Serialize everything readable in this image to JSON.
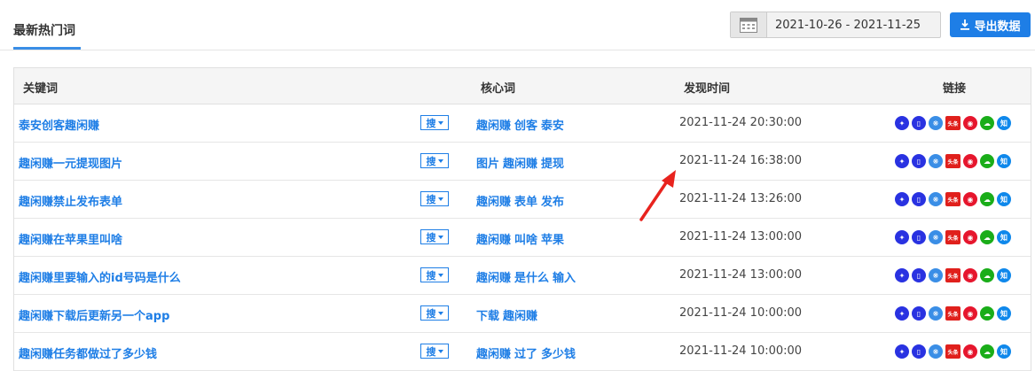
{
  "tab": {
    "label": "最新热门词"
  },
  "date_range": {
    "value": "2021-10-26 - 2021-11-25"
  },
  "export": {
    "label": "导出数据"
  },
  "table": {
    "headers": {
      "keyword": "关键词",
      "core": "核心词",
      "time": "发现时间",
      "links": "链接"
    },
    "search_label": "搜",
    "link_icons": [
      "baidu-icon",
      "mobile-icon",
      "360-icon",
      "toutiao-icon",
      "weibo-icon",
      "wechat-icon",
      "zhihu-icon"
    ],
    "toutiao_text": "头条",
    "zhihu_text": "知",
    "rows": [
      {
        "keyword": "泰安创客趣闲赚",
        "core": [
          "趣闲赚",
          "创客",
          "泰安"
        ],
        "time": "2021-11-24 20:30:00"
      },
      {
        "keyword": "趣闲赚一元提现图片",
        "core": [
          "图片",
          "趣闲赚",
          "提现"
        ],
        "time": "2021-11-24 16:38:00"
      },
      {
        "keyword": "趣闲赚禁止发布表单",
        "core": [
          "趣闲赚",
          "表单",
          "发布"
        ],
        "time": "2021-11-24 13:26:00"
      },
      {
        "keyword": "趣闲赚在苹果里叫啥",
        "core": [
          "趣闲赚",
          "叫啥",
          "苹果"
        ],
        "time": "2021-11-24 13:00:00"
      },
      {
        "keyword": "趣闲赚里要输入的id号码是什么",
        "core": [
          "趣闲赚",
          "是什么",
          "输入"
        ],
        "time": "2021-11-24 13:00:00"
      },
      {
        "keyword": "趣闲赚下载后更新另一个app",
        "core": [
          "下载",
          "趣闲赚"
        ],
        "time": "2021-11-24 10:00:00"
      },
      {
        "keyword": "趣闲赚任务都做过了多少钱",
        "core": [
          "趣闲赚",
          "过了",
          "多少钱"
        ],
        "time": "2021-11-24 10:00:00"
      }
    ]
  },
  "colors": {
    "accent": "#1e7ee6",
    "annotation_arrow": "#e8231e"
  }
}
